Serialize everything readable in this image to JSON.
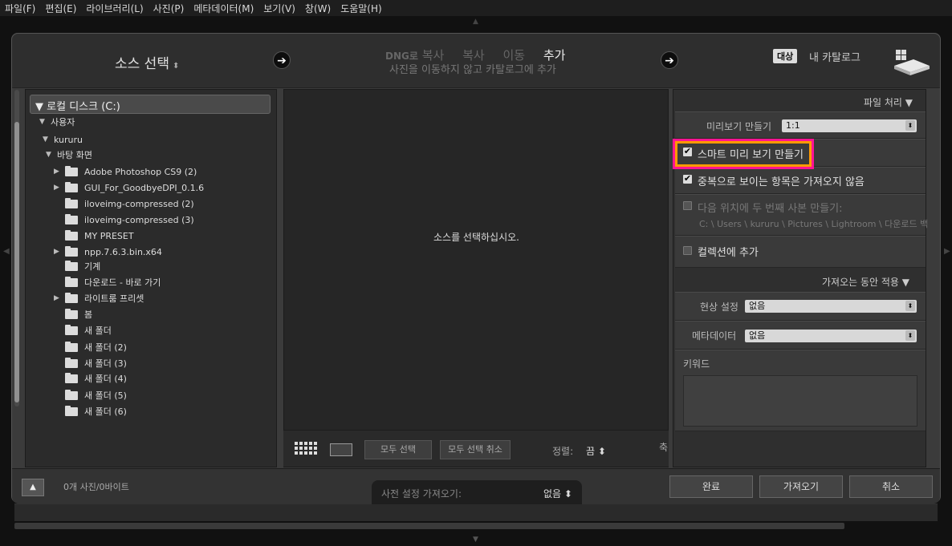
{
  "menu": [
    "파일(F)",
    "편집(E)",
    "라이브러리(L)",
    "사진(P)",
    "메타데이터(M)",
    "보기(V)",
    "창(W)",
    "도움말(H)"
  ],
  "header": {
    "source_title": "소스 선택",
    "modes": {
      "dng": "DNG로",
      "copy_dng": "복사",
      "copy": "복사",
      "move": "이동",
      "add": "추가"
    },
    "mode_desc": "사진을 이동하지 않고 카탈로그에 추가",
    "target_tag": "대상",
    "target_name": "내 카탈로그"
  },
  "tree": {
    "disk": "로컬 디스크 (C:)",
    "users": "사용자",
    "user": "kururu",
    "desktop": "바탕 화면",
    "folders": [
      "Adobe Photoshop CS9 (2)",
      "GUI_For_GoodbyeDPI_0.1.6",
      "iloveimg-compressed (2)",
      "iloveimg-compressed (3)",
      "MY PRESET",
      "npp.7.6.3.bin.x64",
      "기계",
      "다운로드 - 바로 가기",
      "라이트룸 프리셋",
      "봄",
      "새 폴더",
      "새 폴더 (2)",
      "새 폴더 (3)",
      "새 폴더 (4)",
      "새 폴더 (5)",
      "새 폴더 (6)"
    ]
  },
  "center": {
    "message": "소스를 선택하십시오.",
    "select_all": "모두 선택",
    "deselect_all": "모두 선택 취소",
    "sort_label": "정렬:",
    "sort_value": "끔",
    "cut": "축"
  },
  "right": {
    "file_handling": "파일 처리",
    "preview_label": "미리보기 만들기",
    "preview_value": "1:1",
    "smart_preview": "스마트 미리 보기 만들기",
    "no_duplicates": "중복으로 보이는 항목은 가져오지 않음",
    "second_copy": "다음 위치에 두 번째 사본 만들기:",
    "second_copy_path": "C: \\ Users \\ kururu \\ Pictures \\ Lightroom \\ 다운로드 백",
    "add_to_collection": "컬렉션에 추가",
    "apply_during_import": "가져오는 동안 적용",
    "develop_label": "현상 설정",
    "develop_value": "없음",
    "metadata_label": "메타데이터",
    "metadata_value": "없음",
    "keywords_label": "키워드"
  },
  "footer": {
    "status": "0개 사진/0바이트",
    "preset_label": "사전 설정 가져오기:",
    "preset_value": "없음",
    "done": "완료",
    "import": "가져오기",
    "cancel": "취소"
  }
}
